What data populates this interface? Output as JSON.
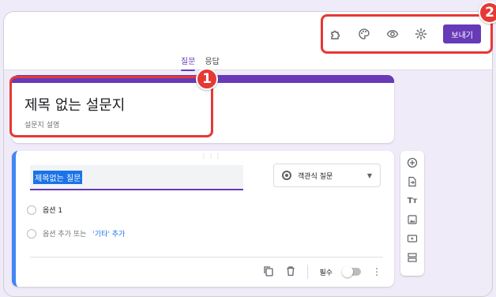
{
  "toolbar": {
    "icons": [
      "addon-icon",
      "palette-icon",
      "preview-eye-icon",
      "settings-gear-icon"
    ],
    "send_label": "보내기"
  },
  "tabs": [
    {
      "label": "질문",
      "active": true
    },
    {
      "label": "응답",
      "active": false
    }
  ],
  "form": {
    "title": "제목 없는 설문지",
    "description": "설문지 설명"
  },
  "question": {
    "title": "제목없는 질문",
    "type_label": "객관식 질문",
    "options": [
      "옵션 1"
    ],
    "add_option_prefix": "옵션 추가 또는",
    "add_other_label": "'기타' 추가",
    "required_label": "필수"
  },
  "side_panel": {
    "icons": [
      "add-question-icon",
      "import-question-icon",
      "add-title-icon",
      "add-image-icon",
      "add-video-icon",
      "add-section-icon"
    ]
  },
  "annotations": {
    "badge1": "1",
    "badge2": "2"
  },
  "colors": {
    "accent": "#673ab7",
    "background": "#f0ebf8",
    "annotation": "#e53935",
    "link": "#1a73e8"
  }
}
